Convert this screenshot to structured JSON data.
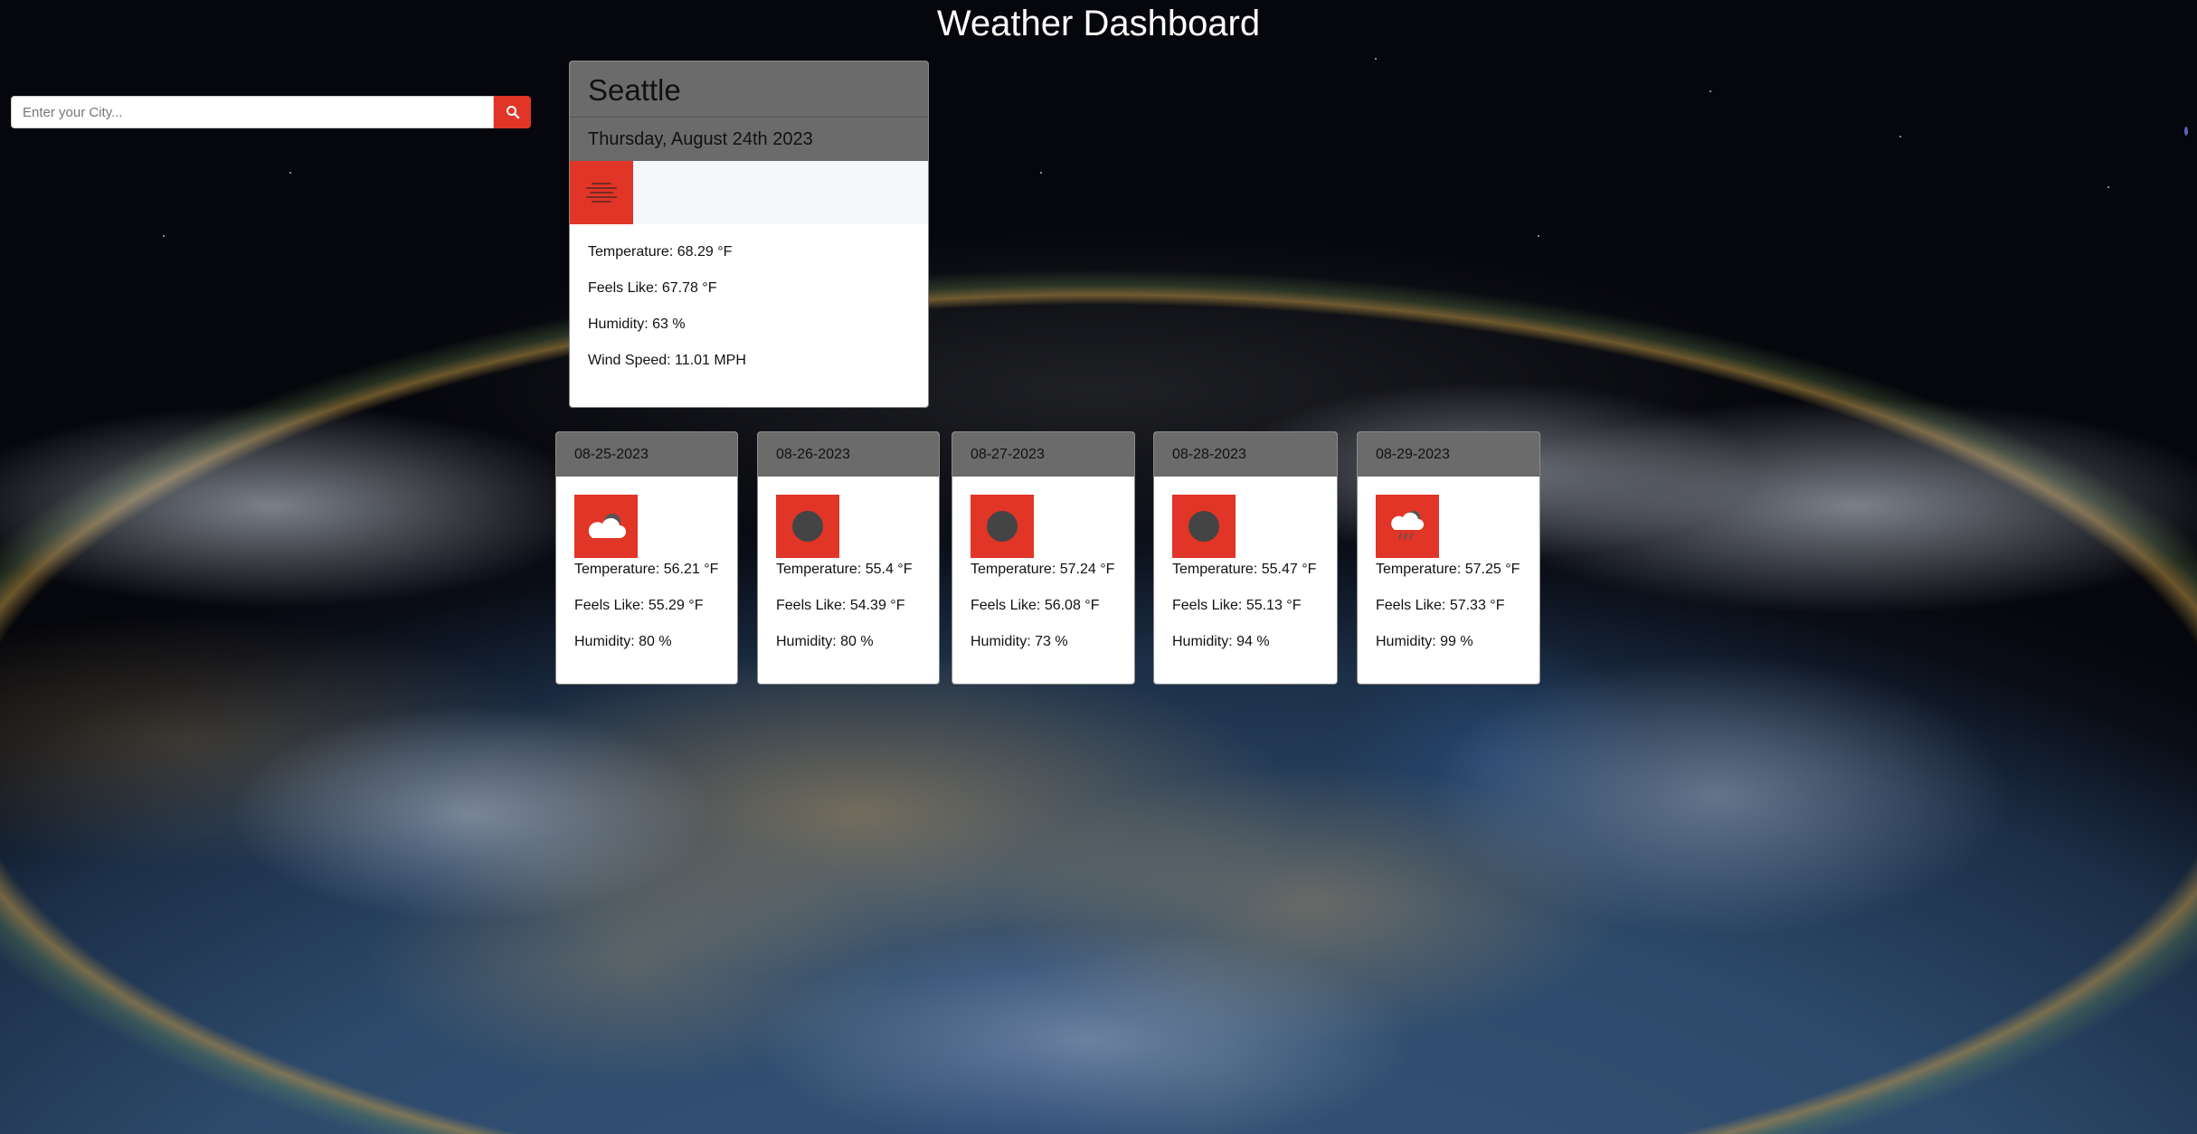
{
  "header": {
    "title": "Weather Dashboard"
  },
  "search": {
    "placeholder": "Enter your City...",
    "button_icon": "search-icon"
  },
  "current": {
    "city": "Seattle",
    "date": "Thursday, August 24th 2023",
    "icon": "haze-icon",
    "temperature": "Temperature: 68.29 °F",
    "feels_like": "Feels Like: 67.78 °F",
    "humidity": "Humidity: 63 %",
    "wind": "Wind Speed: 11.01 MPH"
  },
  "forecast": [
    {
      "date": "08-25-2023",
      "icon": "cloud-icon",
      "temperature": "Temperature: 56.21 °F",
      "feels_like": "Feels Like: 55.29 °F",
      "humidity": "Humidity: 80 %"
    },
    {
      "date": "08-26-2023",
      "icon": "overcast-icon",
      "temperature": "Temperature: 55.4 °F",
      "feels_like": "Feels Like: 54.39 °F",
      "humidity": "Humidity: 80 %"
    },
    {
      "date": "08-27-2023",
      "icon": "overcast-icon",
      "temperature": "Temperature: 57.24 °F",
      "feels_like": "Feels Like: 56.08 °F",
      "humidity": "Humidity: 73 %"
    },
    {
      "date": "08-28-2023",
      "icon": "overcast-icon",
      "temperature": "Temperature: 55.47 °F",
      "feels_like": "Feels Like: 55.13 °F",
      "humidity": "Humidity: 94 %"
    },
    {
      "date": "08-29-2023",
      "icon": "rain-cloud-icon",
      "temperature": "Temperature: 57.25 °F",
      "feels_like": "Feels Like: 57.33 °F",
      "humidity": "Humidity: 99 %"
    }
  ],
  "colors": {
    "accent": "#e03527",
    "card_header": "#6b6b6b",
    "card_body": "#ffffff"
  }
}
